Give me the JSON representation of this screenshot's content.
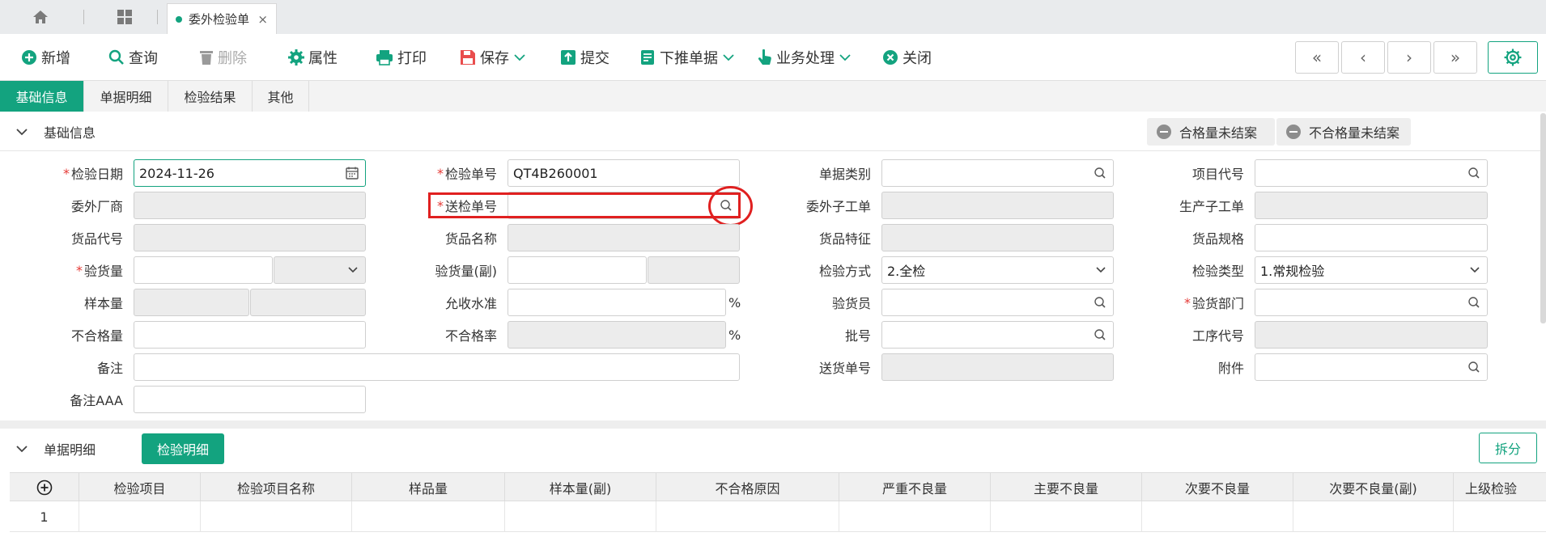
{
  "tabbar": {
    "doc_tab_label": "委外检验单",
    "close_glyph": "×",
    "home_icon": "home-icon",
    "apps_icon": "grid-icon"
  },
  "toolbar": {
    "items": [
      {
        "label": "新增",
        "icon": "plus-circle-icon"
      },
      {
        "label": "查询",
        "icon": "search-icon"
      },
      {
        "label": "删除",
        "icon": "trash-icon"
      },
      {
        "label": "属性",
        "icon": "gear-icon"
      },
      {
        "label": "打印",
        "icon": "printer-icon"
      },
      {
        "label": "保存",
        "icon": "save-icon"
      },
      {
        "label": "提交",
        "icon": "upload-icon"
      },
      {
        "label": "下推单据",
        "icon": "document-icon"
      },
      {
        "label": "业务处理",
        "icon": "hand-pointer-icon"
      },
      {
        "label": "关闭",
        "icon": "close-circle-icon"
      }
    ],
    "nav": [
      "«",
      "‹",
      "›",
      "»"
    ]
  },
  "page_tabs": [
    "基础信息",
    "单据明细",
    "检验结果",
    "其他"
  ],
  "basic_section": {
    "title": "基础信息",
    "chip_pass": "合格量未结案",
    "chip_fail": "不合格量未结案"
  },
  "form": {
    "inspect_date_label": "检验日期",
    "inspect_date_value": "2024-11-26",
    "inspect_no_label": "检验单号",
    "inspect_no_value": "QT4B260001",
    "doc_type_label": "单据类别",
    "project_code_label": "项目代号",
    "vendor_label": "委外厂商",
    "send_no_label": "送检单号",
    "sub_order_label": "委外子工单",
    "prod_order_label": "生产子工单",
    "item_code_label": "货品代号",
    "item_name_label": "货品名称",
    "item_feature_label": "货品特征",
    "item_spec_label": "货品规格",
    "qty_label": "验货量",
    "qty2_label": "验货量(副)",
    "method_label": "检验方式",
    "method_value": "2.全检",
    "inspect_type_label": "检验类型",
    "inspect_type_value": "1.常规检验",
    "sample_label": "样本量",
    "accept_label": "允收水准",
    "pct": "%",
    "inspector_label": "验货员",
    "dept_label": "验货部门",
    "ng_qty_label": "不合格量",
    "ng_rate_label": "不合格率",
    "batch_label": "批号",
    "process_code_label": "工序代号",
    "remark_label": "备注",
    "delivery_no_label": "送货单号",
    "attachment_label": "附件",
    "remark_aaa_label": "备注AAA"
  },
  "detail_section": {
    "title": "单据明细",
    "tab_label": "检验明细",
    "split_label": "拆分"
  },
  "grid": {
    "columns": [
      "检验项目",
      "检验项目名称",
      "样品量",
      "样本量(副)",
      "不合格原因",
      "严重不良量",
      "主要不良量",
      "次要不良量",
      "次要不良量(副)",
      "上级检验"
    ],
    "rows": [
      {
        "no": "1"
      }
    ]
  },
  "colors": {
    "accent": "#13a37f",
    "highlight": "#e02020",
    "required": "#e53935"
  }
}
